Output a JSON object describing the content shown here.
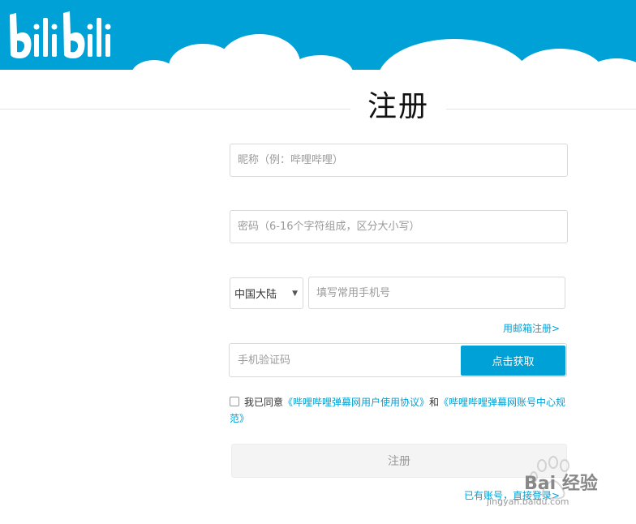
{
  "brand": {
    "logo_text": "bilibili",
    "accent_color": "#00a1d6"
  },
  "page_title": "注册",
  "form": {
    "nickname_placeholder": "昵称（例：哔哩哔哩）",
    "password_placeholder": "密码（6-16个字符组成，区分大小写）",
    "region_selected": "中国大陆",
    "phone_placeholder": "填写常用手机号",
    "email_register_link": "用邮箱注册>",
    "code_placeholder": "手机验证码",
    "get_code_button": "点击获取",
    "agree_prefix": "我已同意",
    "agreement_1": "《哔哩哔哩弹幕网用户使用协议》",
    "agree_and": "和",
    "agreement_2": "《哔哩哔哩弹幕网账号中心规范》",
    "submit_button": "注册",
    "login_link": "已有账号，直接登录>"
  },
  "watermark": {
    "text": "Bai 经验",
    "sub": "jingyan.baidu.com"
  }
}
